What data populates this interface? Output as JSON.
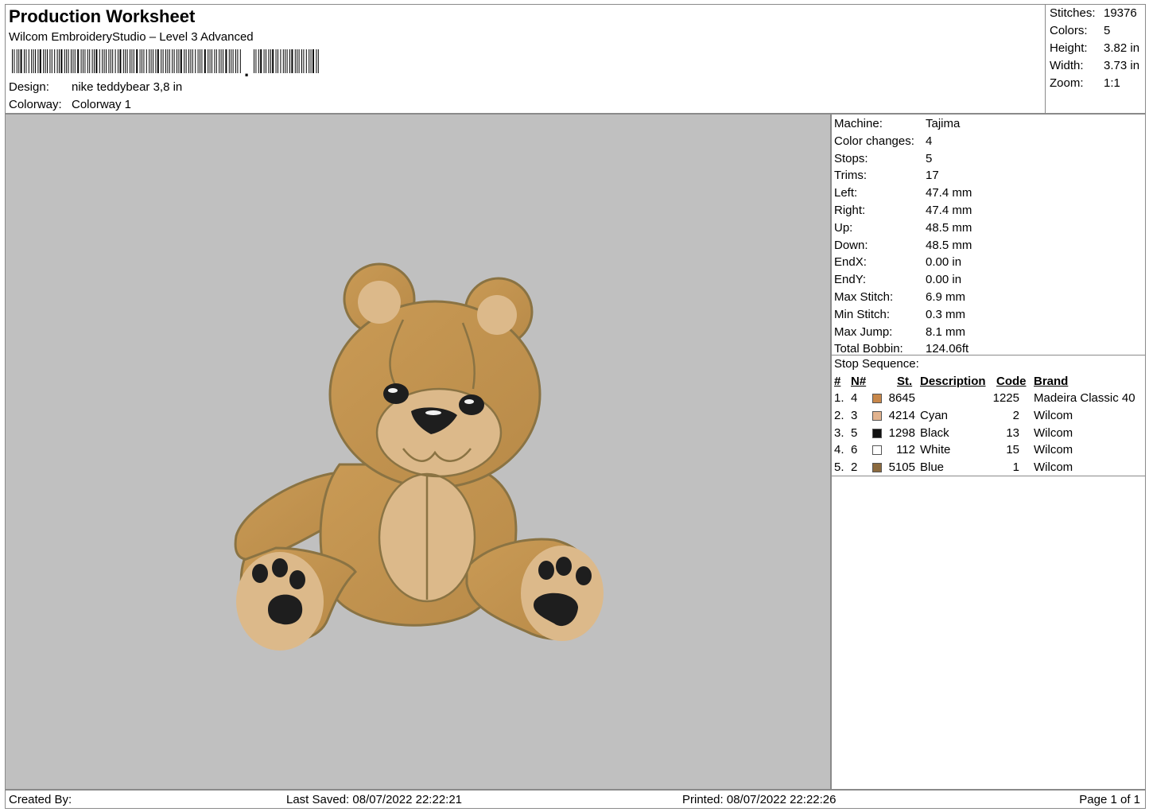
{
  "header": {
    "title": "Production Worksheet",
    "subtitle": "Wilcom EmbroideryStudio – Level 3 Advanced",
    "design_label": "Design:",
    "design_value": "nike teddybear 3,8 in",
    "colorway_label": "Colorway:",
    "colorway_value": "Colorway 1"
  },
  "stats": {
    "stitches_label": "Stitches:",
    "stitches": "19376",
    "colors_label": "Colors:",
    "colors": "5",
    "height_label": "Height:",
    "height": "3.82 in",
    "width_label": "Width:",
    "width": "3.73 in",
    "zoom_label": "Zoom:",
    "zoom": "1:1"
  },
  "machine_info": [
    {
      "label": "Machine:",
      "value": "Tajima"
    },
    {
      "label": "Color changes:",
      "value": "4"
    },
    {
      "label": "Stops:",
      "value": "5"
    },
    {
      "label": "Trims:",
      "value": "17"
    },
    {
      "label": "Left:",
      "value": "47.4 mm"
    },
    {
      "label": "Right:",
      "value": "47.4 mm"
    },
    {
      "label": "Up:",
      "value": "48.5 mm"
    },
    {
      "label": "Down:",
      "value": "48.5 mm"
    },
    {
      "label": "EndX:",
      "value": "0.00 in"
    },
    {
      "label": "EndY:",
      "value": "0.00 in"
    },
    {
      "label": "Max Stitch:",
      "value": "6.9 mm"
    },
    {
      "label": "Min Stitch:",
      "value": "0.3 mm"
    },
    {
      "label": "Max Jump:",
      "value": "8.1 mm"
    },
    {
      "label": "Total Bobbin:",
      "value": "124.06ft"
    }
  ],
  "stop_sequence": {
    "title": "Stop Sequence:",
    "columns": {
      "num": "#",
      "n": "N#",
      "st": "St.",
      "description": "Description",
      "code": "Code",
      "brand": "Brand"
    },
    "rows": [
      {
        "num": "1.",
        "n": "4",
        "color": "#c8874a",
        "st": "8645",
        "description": "",
        "code": "1225",
        "brand": "Madeira Classic 40"
      },
      {
        "num": "2.",
        "n": "3",
        "color": "#e2b38e",
        "st": "4214",
        "description": "Cyan",
        "code": "2",
        "brand": "Wilcom"
      },
      {
        "num": "3.",
        "n": "5",
        "color": "#111111",
        "st": "1298",
        "description": "Black",
        "code": "13",
        "brand": "Wilcom"
      },
      {
        "num": "4.",
        "n": "6",
        "color": "#ffffff",
        "st": "112",
        "description": "White",
        "code": "15",
        "brand": "Wilcom"
      },
      {
        "num": "5.",
        "n": "2",
        "color": "#8b6a3e",
        "st": "5105",
        "description": "Blue",
        "code": "1",
        "brand": "Wilcom"
      }
    ]
  },
  "footer": {
    "created_by": "Created By:",
    "last_saved": "Last Saved: 08/07/2022 22:22:21",
    "printed": "Printed: 08/07/2022 22:22:26",
    "page": "Page 1 of 1"
  },
  "colors": {
    "canvas_bg": "#c0c0c0",
    "bear_body": "#c4954f",
    "bear_outline": "#8a7343",
    "bear_light": "#dcb98a",
    "paw_pad": "#1e1e1e"
  }
}
